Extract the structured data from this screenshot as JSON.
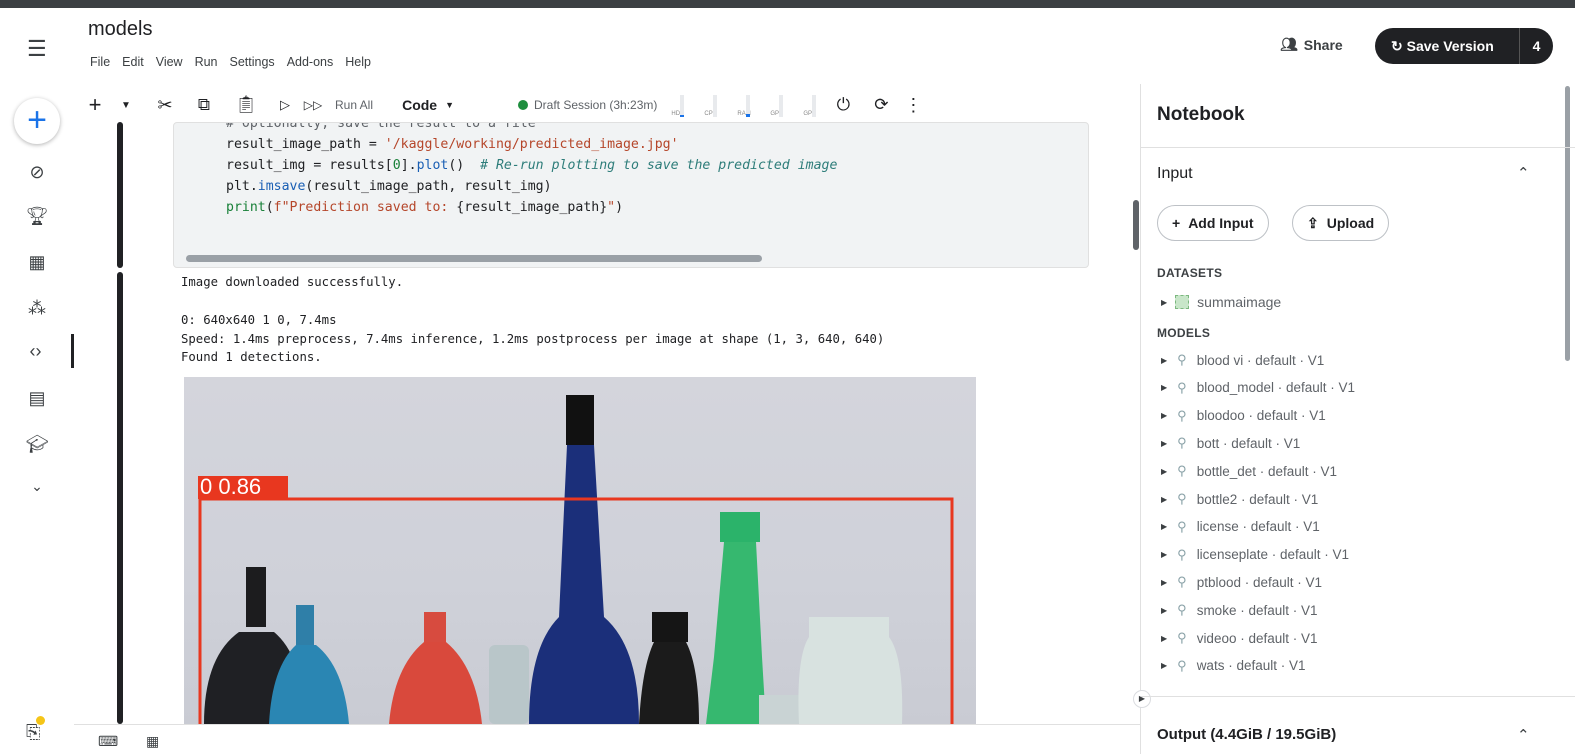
{
  "app": {
    "title": "models",
    "menu": [
      "File",
      "Edit",
      "View",
      "Run",
      "Settings",
      "Add-ons",
      "Help"
    ],
    "share_label": "Share",
    "save_label": "Save Version",
    "save_count": "4"
  },
  "toolbar": {
    "run_all": "Run All",
    "cell_type": "Code",
    "session": "Draft Session (3h:23m)",
    "meters": [
      {
        "label": "HDD",
        "level": 0.1
      },
      {
        "label": "CPU",
        "level": 0.0
      },
      {
        "label": "RAM",
        "level": 0.15
      },
      {
        "label": "GPU",
        "level": 0.0
      },
      {
        "label": "GPU",
        "level": 0.0
      }
    ]
  },
  "code": {
    "lines": [
      "# Optionally, save the result to a file",
      "result_image_path = '/kaggle/working/predicted_image.jpg'",
      "result_img = results[0].plot()  # Re-run plotting to save the predicted image",
      "plt.imsave(result_image_path, result_img)",
      "print(f\"Prediction saved to: {result_image_path}\")"
    ]
  },
  "output": {
    "lines": [
      "Image downloaded successfully.",
      "",
      "0: 640x640 1 0, 7.4ms",
      "Speed: 1.4ms preprocess, 7.4ms inference, 1.2ms postprocess per image at shape (1, 3, 640, 640)",
      "Found 1 detections."
    ],
    "detection_label": "0 0.86"
  },
  "panel": {
    "title": "Notebook",
    "input_title": "Input",
    "add_input": "Add Input",
    "upload": "Upload",
    "datasets_title": "DATASETS",
    "datasets": [
      "summaimage"
    ],
    "models_title": "MODELS",
    "models": [
      "blood vi · default · V1",
      "blood_model · default · V1",
      "bloodoo · default · V1",
      "bott · default · V1",
      "bottle_det · default · V1",
      "bottle2 · default · V1",
      "license · default · V1",
      "licenseplate · default · V1",
      "ptblood · default · V1",
      "smoke · default · V1",
      "videoo · default · V1",
      "wats · default · V1"
    ],
    "output_title": "Output (4.4GiB / 19.5GiB)"
  },
  "colors": {
    "accent": "#1a73e8",
    "detection_box": "#e8371f",
    "session_dot": "#1e8e3e"
  }
}
